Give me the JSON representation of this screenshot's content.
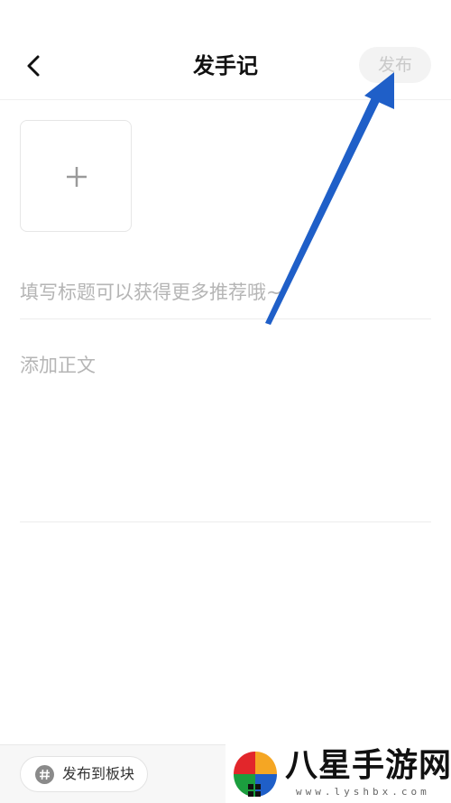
{
  "header": {
    "title": "发手记",
    "publish_label": "发布"
  },
  "editor": {
    "title_placeholder": "填写标题可以获得更多推荐哦~",
    "body_placeholder": "添加正文"
  },
  "bottom_bar": {
    "board_label": "发布到板块"
  },
  "watermark": {
    "text": "八星手游网",
    "url": "www.lyshbx.com"
  },
  "colors": {
    "arrow": "#1f5fc8",
    "placeholder": "#b5b5b5",
    "publish_disabled": "#c9c9c9"
  },
  "icons": {
    "back": "chevron-left-icon",
    "add_image": "plus-icon",
    "board": "hash-icon"
  }
}
